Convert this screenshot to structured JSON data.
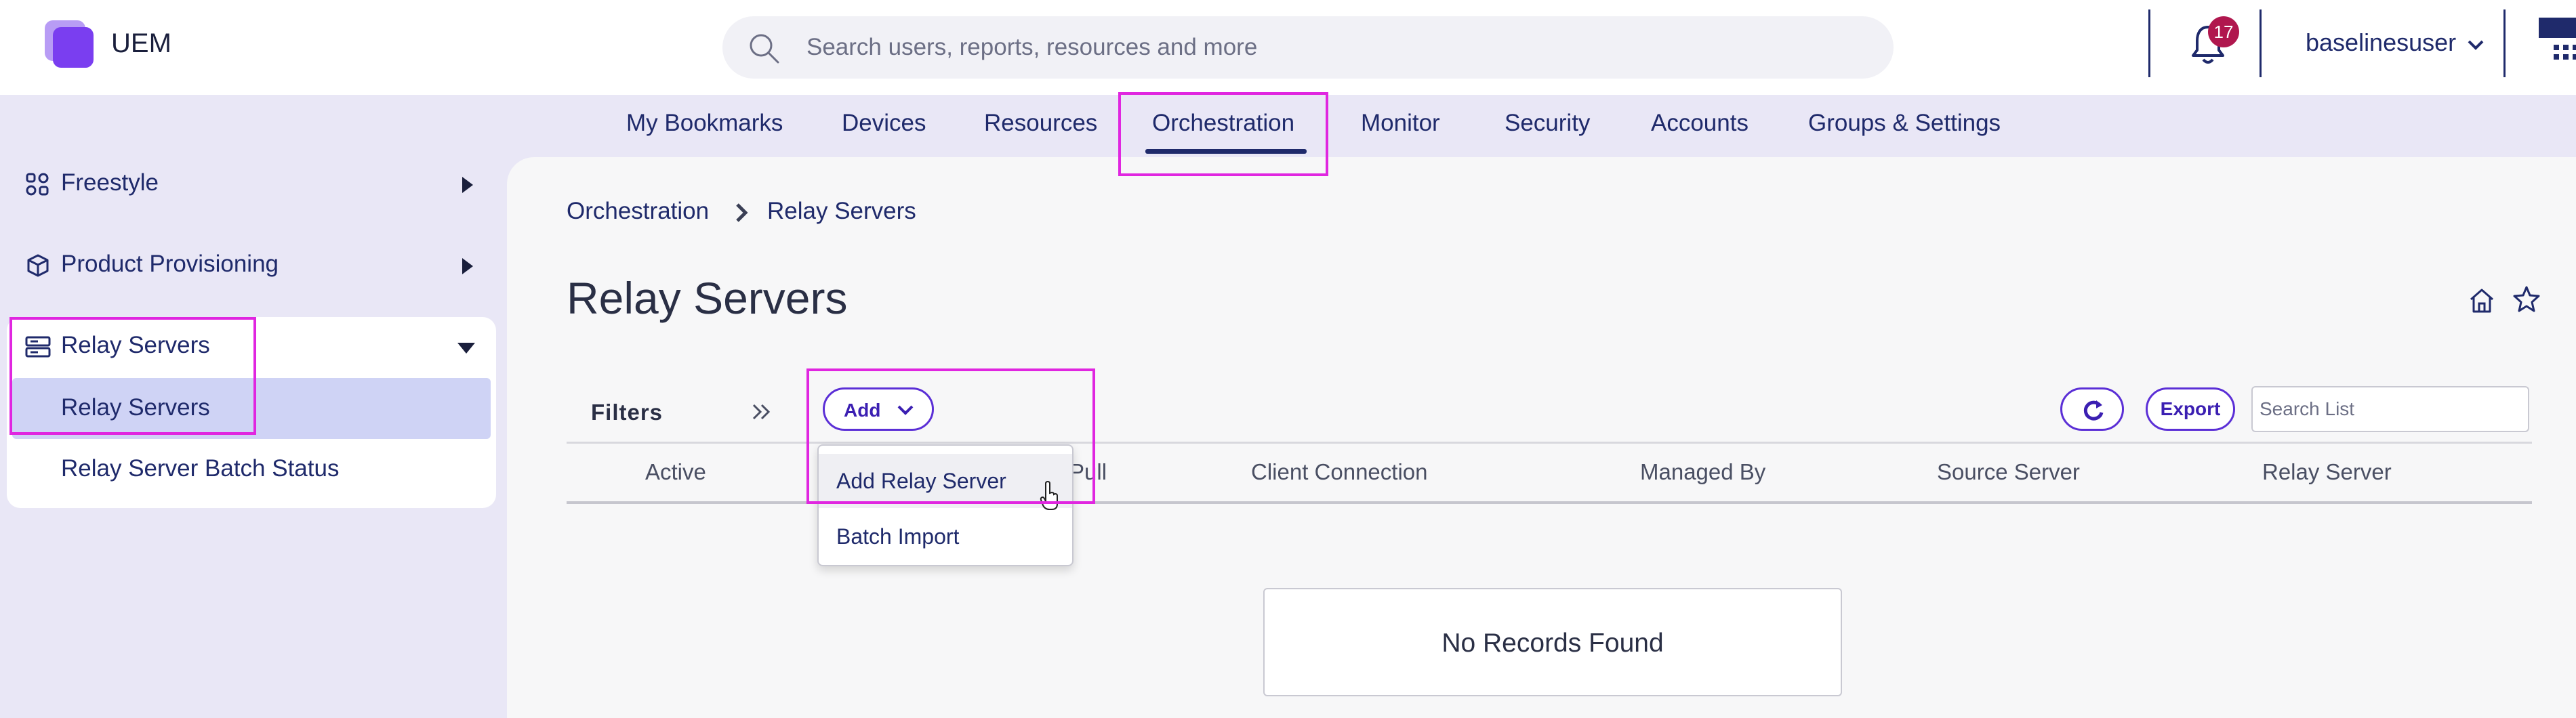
{
  "header": {
    "app_name": "UEM",
    "search_placeholder": "Search users, reports, resources and more",
    "notifications_count": "17",
    "username": "baselinesuser"
  },
  "nav": {
    "items": [
      "My Bookmarks",
      "Devices",
      "Resources",
      "Orchestration",
      "Monitor",
      "Security",
      "Accounts",
      "Groups & Settings"
    ],
    "active": "Orchestration"
  },
  "sidebar": {
    "items": [
      {
        "label": "Freestyle",
        "icon": "freestyle-icon",
        "expanded": false
      },
      {
        "label": "Product Provisioning",
        "icon": "package-icon",
        "expanded": false
      },
      {
        "label": "Relay Servers",
        "icon": "server-icon",
        "expanded": true
      }
    ],
    "sub_items": [
      "Relay Servers",
      "Relay Server Batch Status"
    ],
    "selected_sub_item": "Relay Servers"
  },
  "breadcrumb": [
    "Orchestration",
    "Relay Servers"
  ],
  "page_title": "Relay Servers",
  "toolbar": {
    "filters_label": "Filters",
    "add_label": "Add",
    "export_label": "Export",
    "search_placeholder": "Search List"
  },
  "add_menu": {
    "items": [
      "Add Relay Server",
      "Batch Import"
    ],
    "hovered": "Add Relay Server"
  },
  "table": {
    "columns": [
      "Active",
      "Pull",
      "Client Connection",
      "Managed By",
      "Source Server",
      "Relay Server"
    ],
    "empty_message": "No Records Found"
  },
  "colors": {
    "accent": "#5b2fd6",
    "nav_text": "#1f2a6b",
    "highlight": "#e026e0",
    "badge": "#b0174e"
  }
}
